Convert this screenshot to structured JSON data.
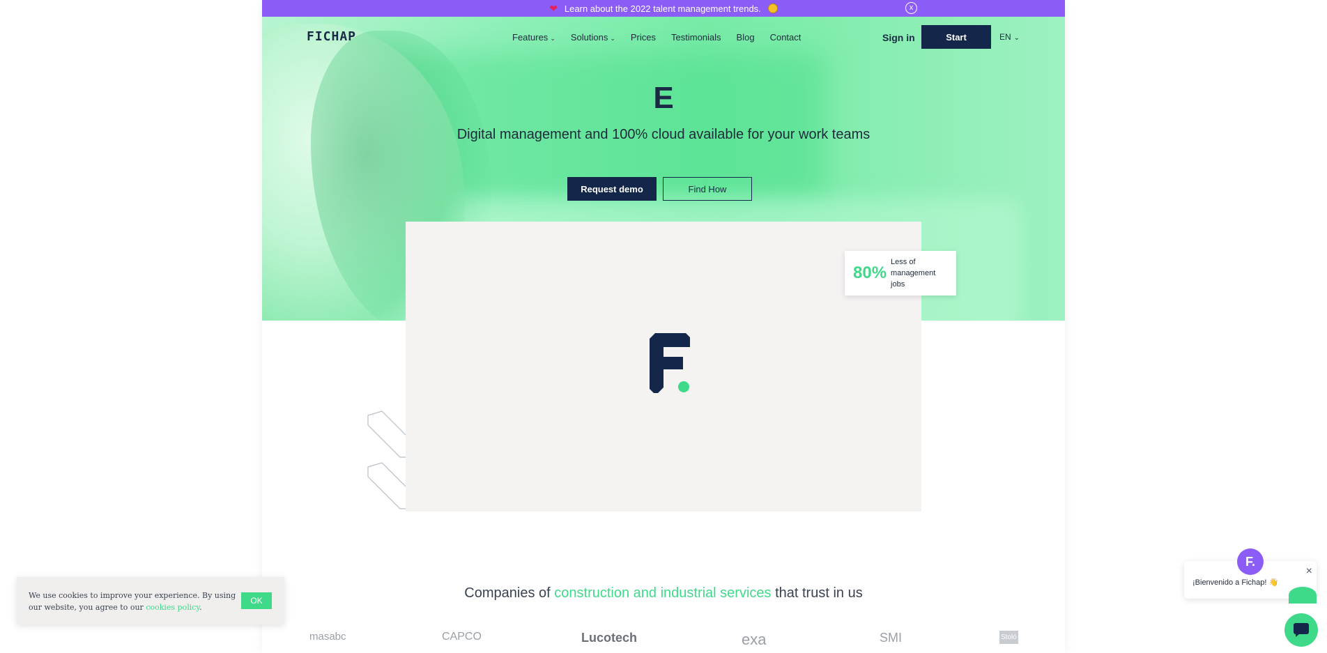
{
  "announcement": {
    "text": "Learn about the 2022 talent management trends.",
    "close": "x"
  },
  "header": {
    "logo": "FICHAP",
    "menu": [
      {
        "label": "Features",
        "dropdown": true
      },
      {
        "label": "Solutions",
        "dropdown": true
      },
      {
        "label": "Prices"
      },
      {
        "label": "Testimonials"
      },
      {
        "label": "Blog"
      },
      {
        "label": "Contact"
      }
    ],
    "signin": "Sign in",
    "start": "Start",
    "lang": "EN"
  },
  "hero": {
    "title": "E",
    "subtitle": "Digital management and 100% cloud available for your work teams",
    "cta_primary": "Request demo",
    "cta_secondary": "Find How"
  },
  "stat": {
    "value": "80%",
    "label": "Less of management jobs"
  },
  "companies": {
    "prefix": "Companies of ",
    "highlight": "construction and industrial services",
    "suffix": " that trust in us"
  },
  "logos": [
    "masabc",
    "CAPCO",
    "Lucotech",
    "exa",
    "SMI",
    "Stoló"
  ],
  "cookie": {
    "text": "We use cookies to improve your experience. By using our website, you agree to our ",
    "link": "cookies policy",
    "end": ".",
    "ok": "OK"
  },
  "chat": {
    "avatar": "F.",
    "message": "¡Bienvenido a Fichap! 👋",
    "close": "×"
  },
  "colors": {
    "accent": "#3fd98a",
    "navy": "#14264a",
    "purple": "#8b5cf6",
    "mint": "#8ff0b8"
  }
}
